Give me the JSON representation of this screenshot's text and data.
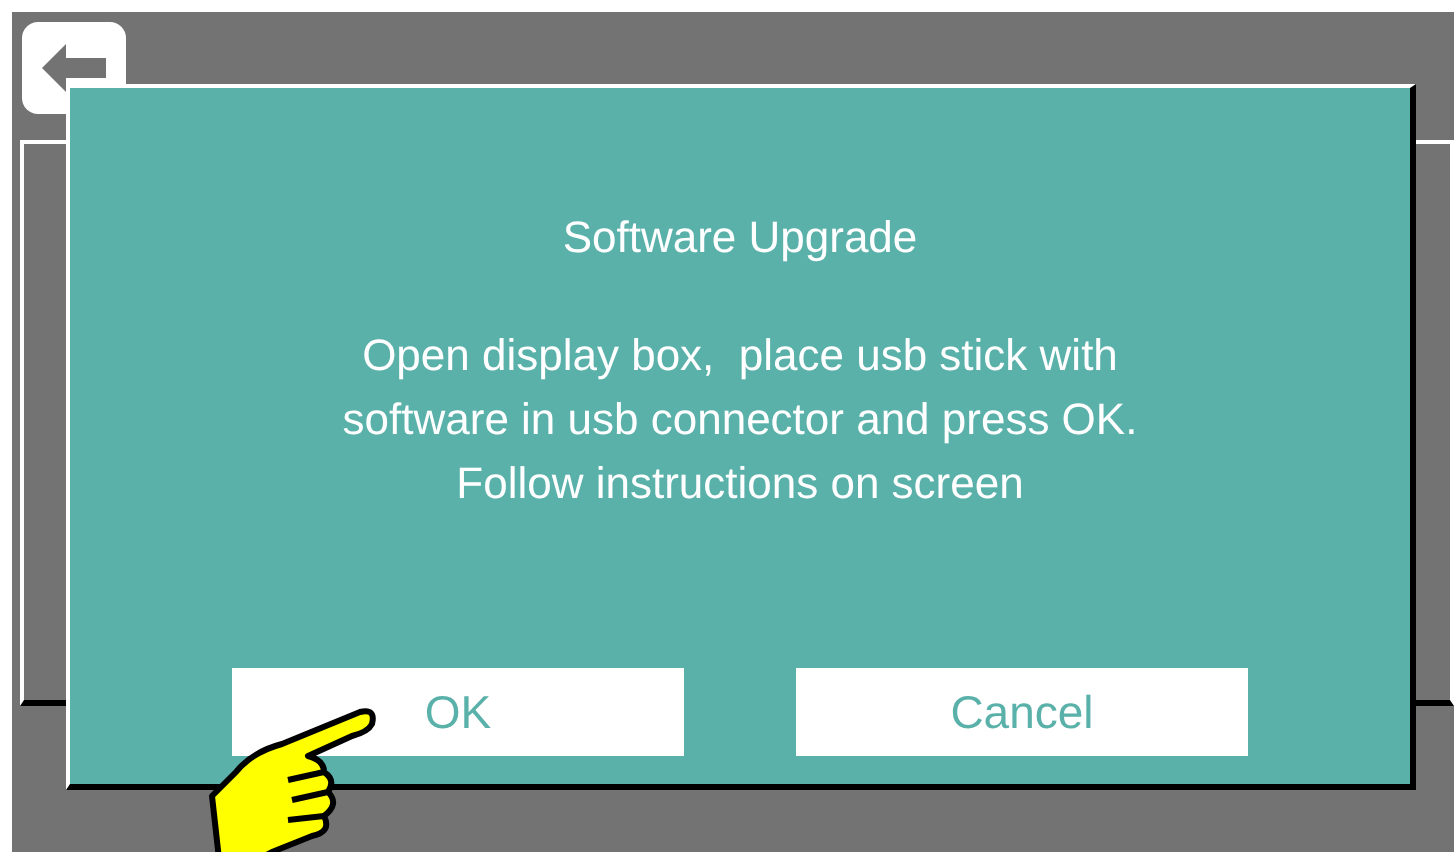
{
  "dialog": {
    "title": "Software Upgrade",
    "message": "Open display box,  place usb stick with\nsoftware in usb connector and press OK.\nFollow instructions on screen",
    "buttons": [
      {
        "label": "OK",
        "pointed": true
      },
      {
        "label": "Cancel",
        "pointed": false
      }
    ]
  }
}
